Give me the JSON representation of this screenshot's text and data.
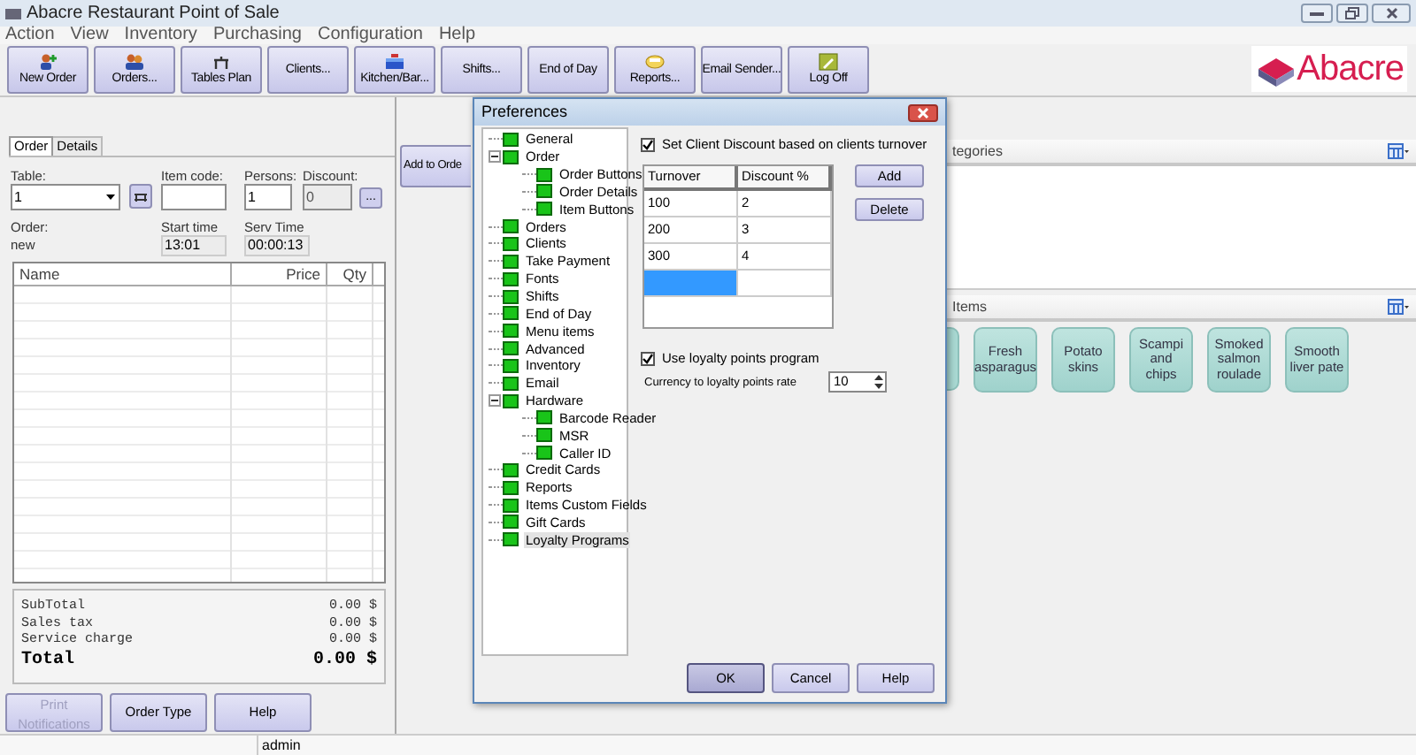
{
  "window": {
    "title": "Abacre Restaurant Point of Sale"
  },
  "menu": [
    "Action",
    "View",
    "Inventory",
    "Purchasing",
    "Configuration",
    "Help"
  ],
  "toolbar": [
    "New Order",
    "Orders...",
    "Tables Plan",
    "Clients...",
    "Kitchen/Bar...",
    "Shifts...",
    "End of Day",
    "Reports...",
    "Email Sender...",
    "Log Off"
  ],
  "logo": {
    "text": "Abacre"
  },
  "order_panel": {
    "tabs": [
      {
        "label": "Order",
        "selected": true
      },
      {
        "label": "Details",
        "selected": false
      }
    ],
    "table": {
      "label": "Table:",
      "value": "1"
    },
    "item_code": {
      "label": "Item code:"
    },
    "persons": {
      "label": "Persons:",
      "value": "1"
    },
    "discount": {
      "label": "Discount:",
      "value": "0",
      "disabled": true
    },
    "discount_button": "...",
    "order": {
      "label": "Order:",
      "value": "new"
    },
    "start_time": {
      "label": "Start time",
      "value": "13:01"
    },
    "serv_time": {
      "label": "Serv Time",
      "value": "00:00:13"
    },
    "columns": [
      "Name",
      "Price",
      "Qty"
    ],
    "totals": [
      {
        "kind": "line",
        "label": "SubTotal",
        "value": "0.00 $"
      },
      {
        "kind": "line",
        "label": "Sales tax",
        "value": "0.00 $"
      },
      {
        "kind": "line",
        "label": "Service charge",
        "value": "0.00 $"
      },
      {
        "kind": "grand",
        "label": "Total",
        "value": "0.00 $"
      }
    ],
    "buttons": [
      {
        "label": "Print Notifications",
        "disabled": true
      },
      {
        "label": "Order Type",
        "disabled": false
      },
      {
        "label": "Help",
        "disabled": false
      }
    ]
  },
  "add_to_order": "Add to Orde",
  "categories": {
    "title": "tegories"
  },
  "items": {
    "title": "Items",
    "tiles": [
      "Fresh asparagus",
      "Potato skins",
      "Scampi and chips",
      "Smoked salmon roulade",
      "Smooth liver pate"
    ]
  },
  "status_bar": {
    "user": "admin"
  },
  "dialog": {
    "title": "Preferences",
    "tree": [
      {
        "label": "General",
        "selected": false
      },
      {
        "label": "Order",
        "selected": false,
        "expanded": true,
        "children": [
          {
            "label": "Order Buttons",
            "selected": false
          },
          {
            "label": "Order Details",
            "selected": false
          },
          {
            "label": "Item Buttons",
            "selected": false
          }
        ]
      },
      {
        "label": "Orders",
        "selected": false
      },
      {
        "label": "Clients",
        "selected": false
      },
      {
        "label": "Take Payment",
        "selected": false
      },
      {
        "label": "Fonts",
        "selected": false
      },
      {
        "label": "Shifts",
        "selected": false
      },
      {
        "label": "End of Day",
        "selected": false
      },
      {
        "label": "Menu items",
        "selected": false
      },
      {
        "label": "Advanced",
        "selected": false
      },
      {
        "label": "Inventory",
        "selected": false
      },
      {
        "label": "Email",
        "selected": false
      },
      {
        "label": "Hardware",
        "selected": false,
        "expanded": true,
        "children": [
          {
            "label": "Barcode Reader",
            "selected": false
          },
          {
            "label": "MSR",
            "selected": false
          },
          {
            "label": "Caller ID",
            "selected": false
          }
        ]
      },
      {
        "label": "Credit Cards",
        "selected": false
      },
      {
        "label": "Reports",
        "selected": false
      },
      {
        "label": "Items Custom Fields",
        "selected": false
      },
      {
        "label": "Gift Cards",
        "selected": false
      },
      {
        "label": "Loyalty Programs",
        "selected": true
      }
    ],
    "discount_check": {
      "label": "Set Client Discount based on clients turnover",
      "checked": true
    },
    "discount_table": {
      "columns": [
        "Turnover",
        "Discount %"
      ],
      "rows": [
        [
          "100",
          "2"
        ],
        [
          "200",
          "3"
        ],
        [
          "300",
          "4"
        ]
      ],
      "new_row_selected": true
    },
    "table_buttons": [
      "Add",
      "Delete"
    ],
    "loyalty_check": {
      "label": "Use loyalty points program",
      "checked": true
    },
    "rate": {
      "label": "Currency to loyalty points rate",
      "value": "10"
    },
    "buttons": [
      "OK",
      "Cancel",
      "Help"
    ]
  }
}
